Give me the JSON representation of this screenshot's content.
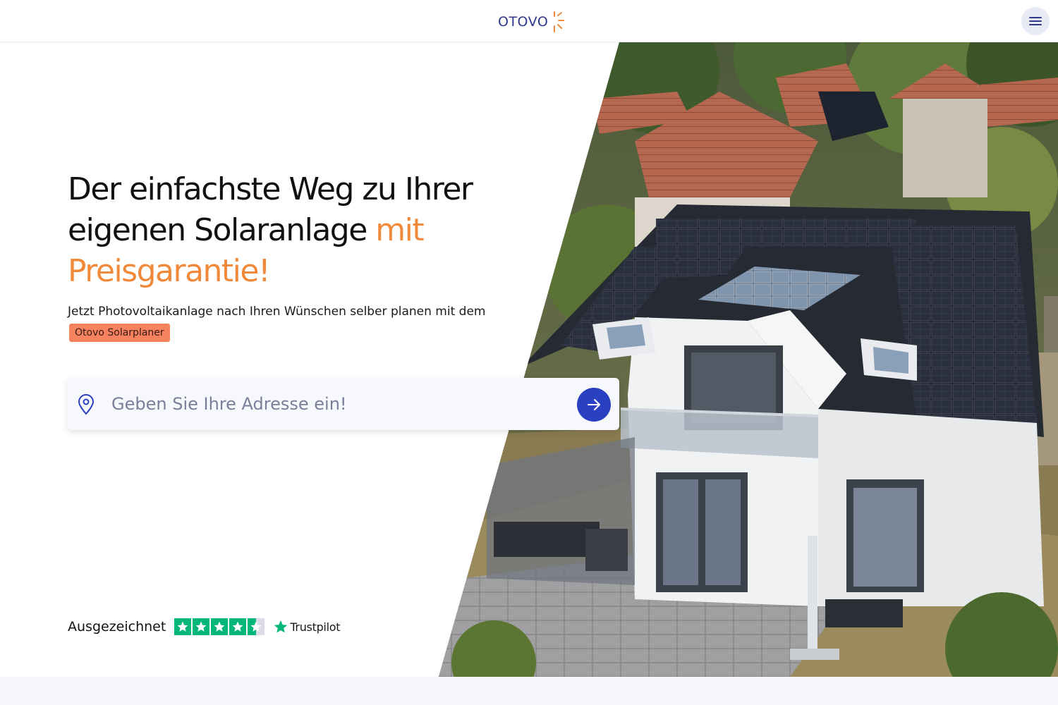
{
  "header": {
    "logo_text": "OTOVO",
    "menu_icon": "hamburger-icon"
  },
  "hero": {
    "headline_part1": "Der einfachste Weg zu Ihrer eigenen Solaranlage ",
    "headline_accent": "mit Preisgarantie!",
    "subline_text": "Jetzt Photovoltaikanlage nach Ihren Wünschen selber planen mit dem",
    "badge_label": "Otovo Solarplaner",
    "image_icon": "house-with-solar-panels-photo"
  },
  "search": {
    "placeholder": "Geben Sie Ihre Adresse ein!",
    "value": "",
    "leading_icon": "map-pin-icon",
    "submit_icon": "arrow-right-icon"
  },
  "trust": {
    "label": "Ausgezeichnet",
    "rating_stars": 4.5,
    "max_stars": 5,
    "brand": "Trustpilot"
  },
  "colors": {
    "accent_orange": "#f08a3a",
    "badge_bg": "#f6825f",
    "primary_blue": "#2940c2",
    "trustpilot_green": "#00b67a",
    "logo_blue": "#2f3a8c"
  }
}
